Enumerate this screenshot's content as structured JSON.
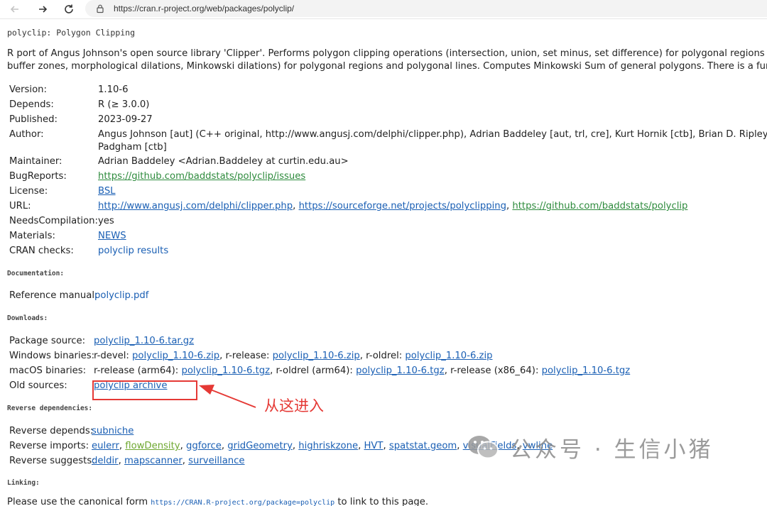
{
  "browser": {
    "url": "https://cran.r-project.org/web/packages/polyclip/",
    "back_icon": "arrow-left-icon",
    "forward_icon": "arrow-right-icon",
    "reload_icon": "reload-icon",
    "lock_icon": "lock-icon"
  },
  "page": {
    "title": "polyclip: Polygon Clipping",
    "description_line1": "R port of Angus Johnson's open source library 'Clipper'. Performs polygon clipping operations (intersection, union, set minus, set difference) for polygonal regions of ar",
    "description_line2": "buffer zones, morphological dilations, Minkowski dilations) for polygonal regions and polygonal lines. Computes Minkowski Sum of general polygons. There is a functio"
  },
  "meta": {
    "version_label": "Version:",
    "version": "1.10-6",
    "depends_label": "Depends:",
    "depends": "R (≥ 3.0.0)",
    "published_label": "Published:",
    "published": "2023-09-27",
    "author_label": "Author:",
    "author_line1": "Angus Johnson [aut] (C++ original, http://www.angusj.com/delphi/clipper.php), Adrian Baddeley [aut, trl, cre], Kurt Hornik [ctb], Brian D. Ripley [ctb]",
    "author_line2": "Padgham [ctb]",
    "maintainer_label": "Maintainer:",
    "maintainer": "Adrian Baddeley <Adrian.Baddeley at curtin.edu.au>",
    "bugreports_label": "BugReports:",
    "bugreports": "https://github.com/baddstats/polyclip/issues",
    "license_label": "License:",
    "license": "BSL",
    "url_label": "URL:",
    "url1": "http://www.angusj.com/delphi/clipper.php",
    "url2": "https://sourceforge.net/projects/polyclipping",
    "url3": "https://github.com/baddstats/polyclip",
    "sep": ", ",
    "needs_label": "NeedsCompilation:",
    "needs": "yes",
    "materials_label": "Materials:",
    "materials": "NEWS",
    "checks_label": "CRAN checks:",
    "checks": "polyclip results"
  },
  "documentation": {
    "heading": "Documentation:",
    "manual_label": "Reference manual:",
    "manual": "polyclip.pdf"
  },
  "downloads": {
    "heading": "Downloads:",
    "source_label": "Package source:",
    "source": "polyclip_1.10-6.tar.gz",
    "win_label": "Windows binaries:",
    "win_devel_label": "r-devel: ",
    "win_devel": "polyclip_1.10-6.zip",
    "win_release_label": ", r-release: ",
    "win_release": "polyclip_1.10-6.zip",
    "win_oldrel_label": ", r-oldrel: ",
    "win_oldrel": "polyclip_1.10-6.zip",
    "mac_label": "macOS binaries:",
    "mac_release_arm_label": "r-release (arm64): ",
    "mac_release_arm": "polyclip_1.10-6.tgz",
    "mac_oldrel_arm_label": ", r-oldrel (arm64): ",
    "mac_oldrel_arm": "polyclip_1.10-6.tgz",
    "mac_release_x86_label": ", r-release (x86_64): ",
    "mac_release_x86": "polyclip_1.10-6.tgz",
    "old_label": "Old sources:",
    "old": "polyclip archive"
  },
  "reverse": {
    "heading": "Reverse dependencies:",
    "depends_label": "Reverse depends:",
    "depends": [
      "subniche"
    ],
    "imports_label": "Reverse imports:",
    "imports": [
      "eulerr",
      "flowDensity",
      "ggforce",
      "gridGeometry",
      "highriskzone",
      "HVT",
      "spatstat.geom",
      "visualFields",
      "vwline"
    ],
    "suggests_label": "Reverse suggests:",
    "suggests": [
      "deldir",
      "mapscanner",
      "surveillance"
    ]
  },
  "linking": {
    "heading": "Linking:",
    "text_before": "Please use the canonical form ",
    "canonical": "https://CRAN.R-project.org/package=polyclip",
    "text_after": " to link to this page."
  },
  "annotation": {
    "text": "从这进入",
    "color": "#e53935"
  },
  "watermark": {
    "text": "公众号 · 生信小猪",
    "icon": "wechat-icon"
  },
  "colors": {
    "link": "#1a5fb4",
    "visited_link": "#2e8b3d",
    "annotation": "#e53935"
  }
}
